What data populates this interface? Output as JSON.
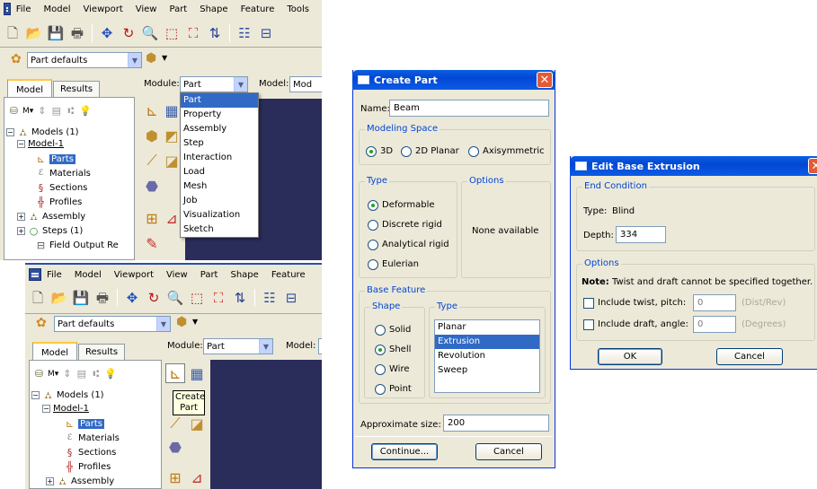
{
  "top_window": {
    "menu": [
      "File",
      "Model",
      "Viewport",
      "View",
      "Part",
      "Shape",
      "Feature",
      "Tools"
    ],
    "part_defaults": "Part defaults",
    "tabs": [
      "Model",
      "Results"
    ],
    "module_label": "Module:",
    "module_value": "Part",
    "model_label": "Model:",
    "model_value": "Mod",
    "module_menu": [
      "Part",
      "Property",
      "Assembly",
      "Step",
      "Interaction",
      "Load",
      "Mesh",
      "Job",
      "Visualization",
      "Sketch"
    ],
    "tree": {
      "models": "Models (1)",
      "model1": "Model-1",
      "parts": "Parts",
      "materials": "Materials",
      "sections": "Sections",
      "profiles": "Profiles",
      "assembly": "Assembly",
      "steps": "Steps (1)",
      "field_output": "Field Output Re"
    }
  },
  "bottom_window": {
    "menu": [
      "File",
      "Model",
      "Viewport",
      "View",
      "Part",
      "Shape",
      "Feature"
    ],
    "part_defaults": "Part defaults",
    "tabs": [
      "Model",
      "Results"
    ],
    "module_label": "Module:",
    "module_value": "Part",
    "model_label": "Model:",
    "tooltip": "Create\nPart",
    "tree": {
      "models": "Models (1)",
      "model1": "Model-1",
      "parts": "Parts",
      "materials": "Materials",
      "sections": "Sections",
      "profiles": "Profiles",
      "assembly": "Assembly"
    }
  },
  "create_part": {
    "title": "Create Part",
    "name_label": "Name:",
    "name_value": "Beam",
    "modeling_space": {
      "legend": "Modeling Space",
      "options": [
        "3D",
        "2D Planar",
        "Axisymmetric"
      ],
      "selected": "3D"
    },
    "type": {
      "legend": "Type",
      "options": [
        "Deformable",
        "Discrete rigid",
        "Analytical rigid",
        "Eulerian"
      ],
      "selected": "Deformable"
    },
    "options": {
      "legend": "Options",
      "text": "None available"
    },
    "base_feature": {
      "legend": "Base Feature",
      "shape_legend": "Shape",
      "shapes": [
        "Solid",
        "Shell",
        "Wire",
        "Point"
      ],
      "selected_shape": "Shell",
      "type_legend": "Type",
      "types": [
        "Planar",
        "Extrusion",
        "Revolution",
        "Sweep"
      ],
      "selected_type": "Extrusion"
    },
    "approx_size_label": "Approximate size:",
    "approx_size_value": "200",
    "continue_btn": "Continue...",
    "cancel_btn": "Cancel"
  },
  "edit_extrusion": {
    "title": "Edit Base Extrusion",
    "end_condition_legend": "End Condition",
    "type_label": "Type:",
    "type_value": "Blind",
    "depth_label": "Depth:",
    "depth_value": "334",
    "options_legend": "Options",
    "note_bold": "Note:",
    "note_text": "Twist and draft cannot be specified together.",
    "twist_label": "Include twist, pitch:",
    "twist_value": "0",
    "twist_unit": "(Dist/Rev)",
    "draft_label": "Include draft, angle:",
    "draft_value": "0",
    "draft_unit": "(Degrees)",
    "ok_btn": "OK",
    "cancel_btn": "Cancel"
  },
  "colors": {
    "viewport": "#2a2c5a",
    "title_bar": "#0a5fe3",
    "selection": "#316ac5",
    "xp_face": "#ece9d8"
  }
}
